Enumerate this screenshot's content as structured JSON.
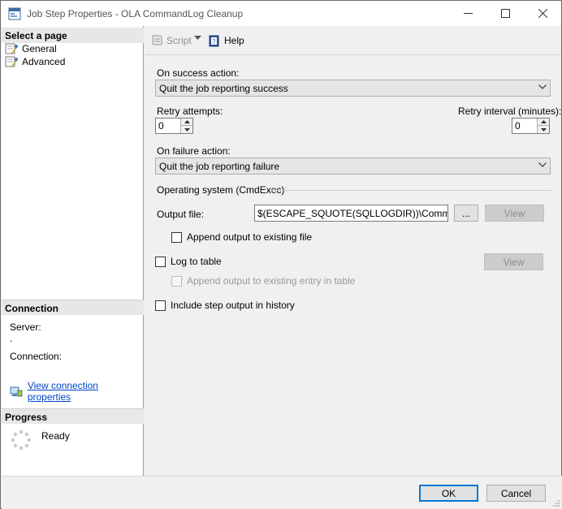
{
  "window": {
    "title": "Job Step Properties - OLA CommandLog Cleanup"
  },
  "sidebar": {
    "select_page_header": "Select a page",
    "pages": [
      {
        "label": "General",
        "icon": "page-wrench-icon"
      },
      {
        "label": "Advanced",
        "icon": "page-wrench-icon"
      }
    ],
    "connection_header": "Connection",
    "server_label": "Server:",
    "server_value": ".",
    "connection_label": "Connection:",
    "view_connection_link": "View connection properties",
    "progress_header": "Progress",
    "progress_status": "Ready"
  },
  "toolbar": {
    "script_label": "Script",
    "help_label": "Help"
  },
  "form": {
    "on_success_label": "On success action:",
    "on_success_value": "Quit the job reporting success",
    "retry_attempts_label": "Retry attempts:",
    "retry_attempts_value": "0",
    "retry_interval_label": "Retry interval (minutes):",
    "retry_interval_value": "0",
    "on_failure_label": "On failure action:",
    "on_failure_value": "Quit the job reporting failure",
    "os_group_label": "Operating system (CmdExec)",
    "output_file_label": "Output file:",
    "output_file_value": "$(ESCAPE_SQUOTE(SQLLOGDIR))\\CommandLog",
    "browse_label": "...",
    "view_label": "View",
    "append_output_label": "Append output to existing file",
    "log_to_table_label": "Log to table",
    "view_table_label": "View",
    "append_table_label": "Append output to existing entry in table",
    "include_history_label": "Include step output in history"
  },
  "buttons": {
    "ok": "OK",
    "cancel": "Cancel"
  },
  "colors": {
    "link": "#0044cc",
    "default_button_border": "#0078d7"
  }
}
